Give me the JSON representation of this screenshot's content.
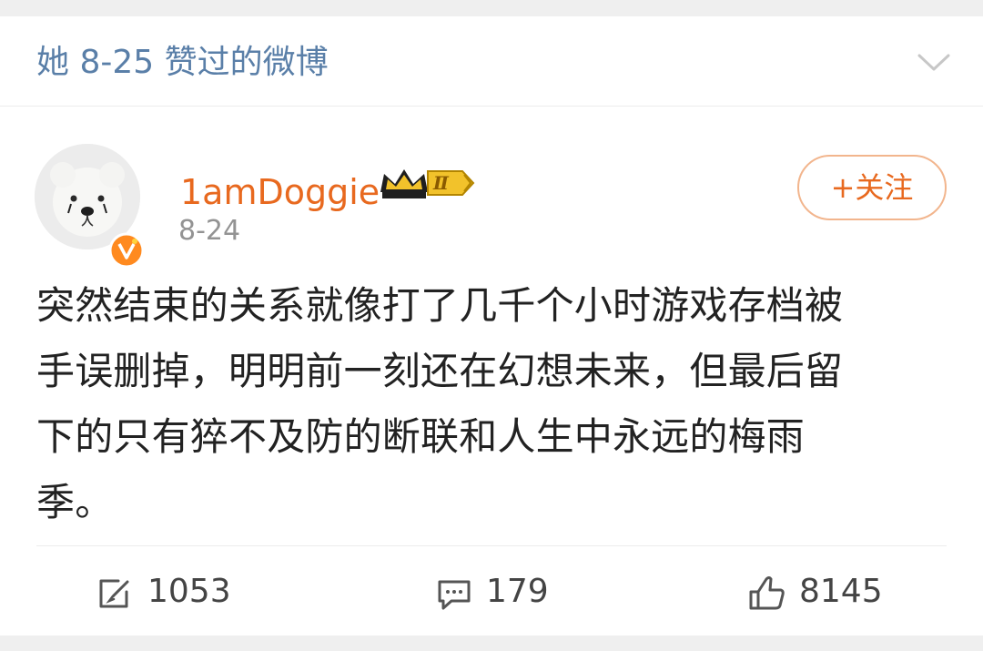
{
  "header": {
    "title": "她 8-25 赞过的微博",
    "collapse_icon": "chevron-down-icon"
  },
  "post": {
    "author": {
      "name": "1amDoggie",
      "avatar": "white-teddy-bear-avatar",
      "verified_icon": "verified-v-badge",
      "level_badge": "Ⅱ"
    },
    "date": "8-24",
    "follow_label": "+关注",
    "lines": [
      "突然结束的关系就像打了几千个小时游戏存档被",
      "手误删掉，明明前一刻还在幻想未来，但最后留",
      "下的只有猝不及防的断联和人生中永远的梅雨",
      "季。"
    ]
  },
  "actions": {
    "repost": {
      "icon": "repost-icon",
      "count": "1053"
    },
    "comment": {
      "icon": "comment-icon",
      "count": "179"
    },
    "like": {
      "icon": "thumbs-up-icon",
      "count": "8145"
    }
  },
  "colors": {
    "header_blue": "#5a7fa8",
    "username_orange": "#e8691f",
    "follow_border": "#f2b58d",
    "text_dark": "#222222",
    "meta_gray": "#939393"
  }
}
